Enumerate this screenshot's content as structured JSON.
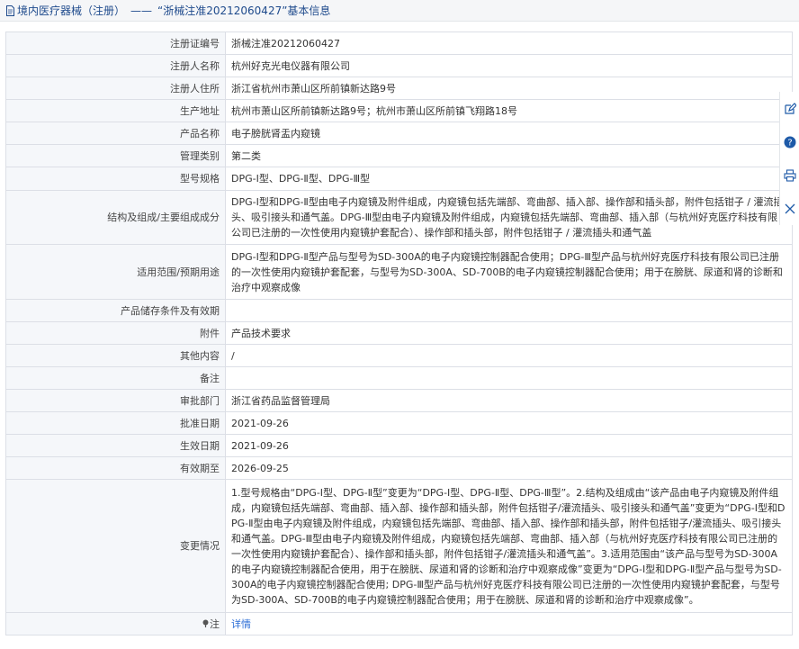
{
  "header": {
    "section": "境内医疗器械（注册）",
    "separator": "——",
    "title": "“浙械注准20212060427”基本信息"
  },
  "rows": [
    {
      "label": "注册证编号",
      "value": "浙械注准20212060427"
    },
    {
      "label": "注册人名称",
      "value": "杭州好克光电仪器有限公司"
    },
    {
      "label": "注册人住所",
      "value": "浙江省杭州市萧山区所前镇新达路9号"
    },
    {
      "label": "生产地址",
      "value": "杭州市萧山区所前镇新达路9号；杭州市萧山区所前镇飞翔路18号"
    },
    {
      "label": "产品名称",
      "value": "电子膀胱肾盂内窥镜"
    },
    {
      "label": "管理类别",
      "value": "第二类"
    },
    {
      "label": "型号规格",
      "value": "DPG-Ⅰ型、DPG-Ⅱ型、DPG-Ⅲ型"
    },
    {
      "label": "结构及组成/主要组成成分",
      "value": "DPG-Ⅰ型和DPG-Ⅱ型由电子内窥镜及附件组成，内窥镜包括先端部、弯曲部、插入部、操作部和插头部，附件包括钳子 / 灌流插头、吸引接头和通气盖。DPG-Ⅲ型由电子内窥镜及附件组成，内窥镜包括先端部、弯曲部、插入部（与杭州好克医疗科技有限公司已注册的一次性使用内窥镜护套配合）、操作部和插头部，附件包括钳子 / 灌流插头和通气盖"
    },
    {
      "label": "适用范围/预期用途",
      "value": "DPG-Ⅰ型和DPG-Ⅱ型产品与型号为SD-300A的电子内窥镜控制器配合使用；DPG-Ⅲ型产品与杭州好克医疗科技有限公司已注册的一次性使用内窥镜护套配套，与型号为SD-300A、SD-700B的电子内窥镜控制器配合使用；用于在膀胱、尿道和肾的诊断和治疗中观察成像"
    },
    {
      "label": "产品储存条件及有效期",
      "value": ""
    },
    {
      "label": "附件",
      "value": "产品技术要求"
    },
    {
      "label": "其他内容",
      "value": "/"
    },
    {
      "label": "备注",
      "value": ""
    },
    {
      "label": "审批部门",
      "value": "浙江省药品监督管理局"
    },
    {
      "label": "批准日期",
      "value": "2021-09-26"
    },
    {
      "label": "生效日期",
      "value": "2021-09-26"
    },
    {
      "label": "有效期至",
      "value": "2026-09-25"
    },
    {
      "label": "变更情况",
      "value": "1.型号规格由“DPG-Ⅰ型、DPG-Ⅱ型”变更为“DPG-Ⅰ型、DPG-Ⅱ型、DPG-Ⅲ型”。2.结构及组成由“该产品由电子内窥镜及附件组成，内窥镜包括先端部、弯曲部、插入部、操作部和插头部，附件包括钳子/灌流插头、吸引接头和通气盖”变更为“DPG-Ⅰ型和DPG-Ⅱ型由电子内窥镜及附件组成，内窥镜包括先端部、弯曲部、插入部、操作部和插头部，附件包括钳子/灌流插头、吸引接头和通气盖。DPG-Ⅲ型由电子内窥镜及附件组成，内窥镜包括先端部、弯曲部、插入部（与杭州好克医疗科技有限公司已注册的一次性使用内窥镜护套配合）、操作部和插头部，附件包括钳子/灌流插头和通气盖”。3.适用范围由“该产品与型号为SD-300A的电子内窥镜控制器配合使用，用于在膀胱、尿道和肾的诊断和治疗中观察成像”变更为“DPG-Ⅰ型和DPG-Ⅱ型产品与型号为SD-300A的电子内窥镜控制器配合使用; DPG-Ⅲ型产品与杭州好克医疗科技有限公司已注册的一次性使用内窥镜护套配套，与型号为SD-300A、SD-700B的电子内窥镜控制器配合使用；用于在膀胱、尿道和肾的诊断和治疗中观察成像”。"
    }
  ],
  "note": {
    "label": "注",
    "link": "详情"
  },
  "colors": {
    "header_text": "#1e4a8c",
    "link": "#2a6cd6",
    "label_bg": "#f5f7fa",
    "border": "#dcdfe6"
  },
  "side_tools": [
    "edit-icon",
    "help-icon",
    "print-icon",
    "close-icon"
  ]
}
